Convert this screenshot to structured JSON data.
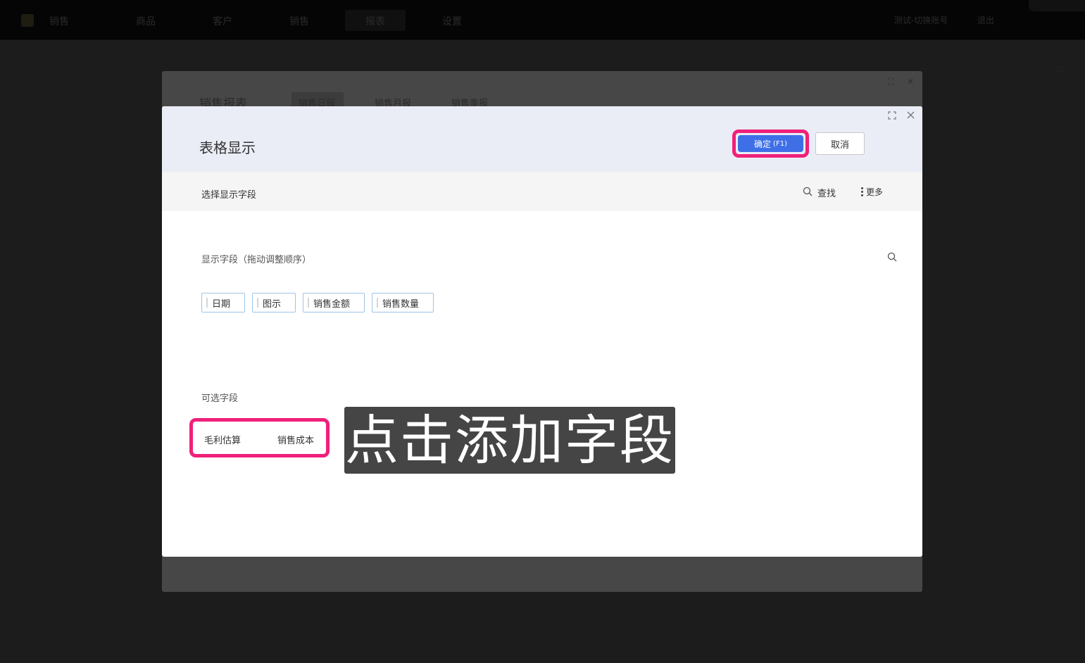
{
  "topnav": {
    "items": [
      "销售",
      "商品",
      "客户",
      "销售",
      "报表",
      "设置"
    ],
    "user": "测试-切换账号",
    "logout": "退出"
  },
  "bg_dialog": {
    "title": "销售报表",
    "tabs": [
      "销售日报",
      "销售月报",
      "销售季报"
    ]
  },
  "dialog": {
    "title": "表格显示",
    "confirm_label": "确定",
    "confirm_shortcut": "(F1)",
    "cancel_label": "取消",
    "expand_icon": "expand-icon",
    "close_icon": "close-icon"
  },
  "toolbar": {
    "title": "选择显示字段",
    "find_label": "查找",
    "more_label": "更多"
  },
  "display_fields": {
    "label": "显示字段（拖动调整顺序）",
    "items": [
      "日期",
      "图示",
      "销售金额",
      "销售数量"
    ]
  },
  "available_fields": {
    "label": "可选字段",
    "items": [
      "毛利估算",
      "销售成本"
    ]
  },
  "hint": "点击添加字段",
  "colors": {
    "accent": "#3f6fe7",
    "highlight": "#f0207a",
    "chip_border": "#9fc4e8"
  }
}
